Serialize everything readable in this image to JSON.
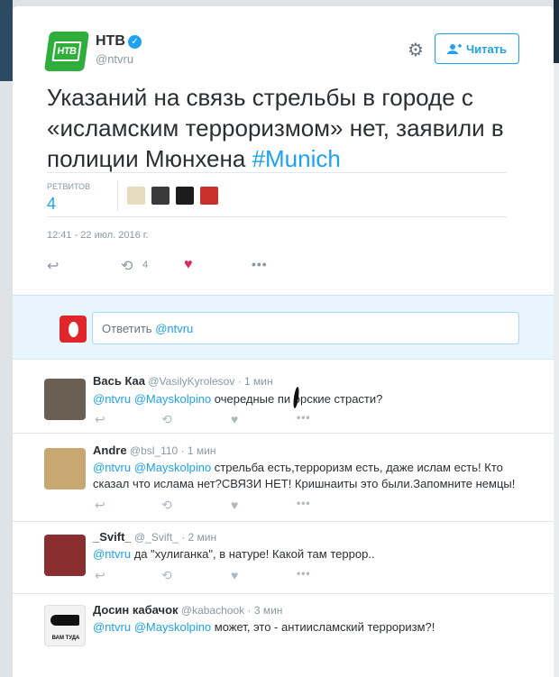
{
  "tweet": {
    "display_name": "НТВ",
    "handle": "@ntvru",
    "logo_text": "НТВ",
    "follow_label": "Читать",
    "text_main": "Указаний на связь стрельбы в городе с «исламским терроризмом» нет, заявили в полиции Мюнхена ",
    "hashtag": "#Munich",
    "retweets_label": "РЕТВИТОВ",
    "retweets_count": "4",
    "timestamp": "12:41 - 22 июл. 2016 г.",
    "action_retweet_count": "4"
  },
  "reply_box": {
    "placeholder_prefix": "Ответить ",
    "placeholder_mention": "@ntvru"
  },
  "replies": [
    {
      "name": "Вась Каа",
      "handle": "@VasilyKyrolesov",
      "time": "1 мин",
      "mentions": "@ntvru @Mayskolpino",
      "text": " очередные пи  орские страсти?"
    },
    {
      "name": "Andre",
      "handle": "@bsl_110",
      "time": "1 мин",
      "mentions": "@ntvru @Mayskolpino",
      "text": " стрельба есть,терроризм есть, даже ислам есть! Кто сказал что ислама нет?СВЯЗИ НЕТ! Кришнаиты  это были.Запомните немцы!"
    },
    {
      "name": "_Svift_",
      "handle": "@_Svift_",
      "time": "2 мин",
      "mentions": "@ntvru",
      "text": " да \"хулиганка\", в натуре! Какой там террор.."
    },
    {
      "name": "Досин кабачок",
      "handle": "@kabachook",
      "time": "3 мин",
      "mentions": "@ntvru @Mayskolpino",
      "text": " может, это - антиисламский терроризм?!",
      "avatar_caption": "ВАМ ТУДА"
    }
  ],
  "icons": {
    "settings": "gear-icon",
    "follow": "add-user-icon",
    "verified": "verified-badge-icon",
    "reply": "reply-icon",
    "retweet": "retweet-icon",
    "like": "heart-icon",
    "more": "more-icon"
  },
  "colors": {
    "accent": "#1da1f2",
    "like_active": "#e0245e",
    "brand_green": "#2fae3c"
  }
}
